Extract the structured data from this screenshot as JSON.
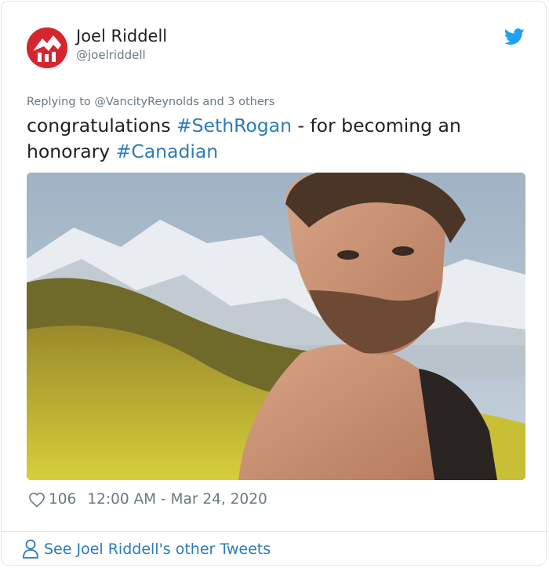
{
  "author": {
    "name": "Joel Riddell",
    "handle": "@joelriddell",
    "avatar_color": "#d4262f"
  },
  "brand_icon": "twitter-bird-icon",
  "accent_color": "#2b7bb9",
  "tweet": {
    "replying_to": "Replying to @VancityReynolds and 3 others",
    "text_1": "congratulations ",
    "hashtag_1": "#SethRogan",
    "text_2": " - for becoming an honorary ",
    "hashtag_2": "#Canadian",
    "like_count": "106",
    "timestamp": "12:00 AM - Mar 24, 2020"
  },
  "media": {
    "icon": "photo-image"
  },
  "footer": {
    "link_label": "See Joel Riddell's other Tweets",
    "icon": "person-icon"
  }
}
